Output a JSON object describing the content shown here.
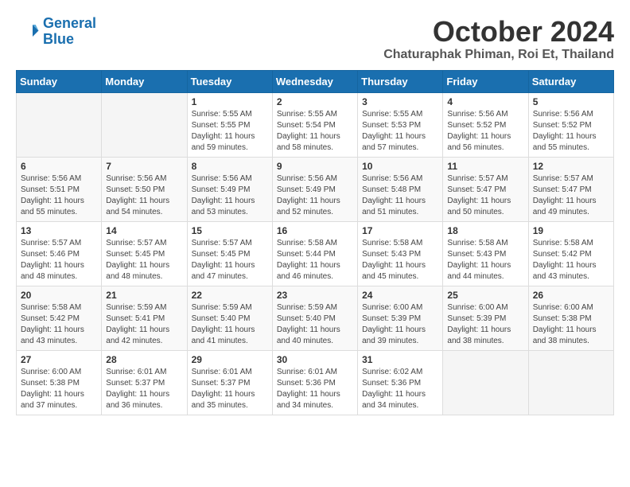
{
  "header": {
    "logo_line1": "General",
    "logo_line2": "Blue",
    "month": "October 2024",
    "location": "Chaturaphak Phiman, Roi Et, Thailand"
  },
  "weekdays": [
    "Sunday",
    "Monday",
    "Tuesday",
    "Wednesday",
    "Thursday",
    "Friday",
    "Saturday"
  ],
  "weeks": [
    [
      {
        "day": "",
        "info": ""
      },
      {
        "day": "",
        "info": ""
      },
      {
        "day": "1",
        "info": "Sunrise: 5:55 AM\nSunset: 5:55 PM\nDaylight: 11 hours and 59 minutes."
      },
      {
        "day": "2",
        "info": "Sunrise: 5:55 AM\nSunset: 5:54 PM\nDaylight: 11 hours and 58 minutes."
      },
      {
        "day": "3",
        "info": "Sunrise: 5:55 AM\nSunset: 5:53 PM\nDaylight: 11 hours and 57 minutes."
      },
      {
        "day": "4",
        "info": "Sunrise: 5:56 AM\nSunset: 5:52 PM\nDaylight: 11 hours and 56 minutes."
      },
      {
        "day": "5",
        "info": "Sunrise: 5:56 AM\nSunset: 5:52 PM\nDaylight: 11 hours and 55 minutes."
      }
    ],
    [
      {
        "day": "6",
        "info": "Sunrise: 5:56 AM\nSunset: 5:51 PM\nDaylight: 11 hours and 55 minutes."
      },
      {
        "day": "7",
        "info": "Sunrise: 5:56 AM\nSunset: 5:50 PM\nDaylight: 11 hours and 54 minutes."
      },
      {
        "day": "8",
        "info": "Sunrise: 5:56 AM\nSunset: 5:49 PM\nDaylight: 11 hours and 53 minutes."
      },
      {
        "day": "9",
        "info": "Sunrise: 5:56 AM\nSunset: 5:49 PM\nDaylight: 11 hours and 52 minutes."
      },
      {
        "day": "10",
        "info": "Sunrise: 5:56 AM\nSunset: 5:48 PM\nDaylight: 11 hours and 51 minutes."
      },
      {
        "day": "11",
        "info": "Sunrise: 5:57 AM\nSunset: 5:47 PM\nDaylight: 11 hours and 50 minutes."
      },
      {
        "day": "12",
        "info": "Sunrise: 5:57 AM\nSunset: 5:47 PM\nDaylight: 11 hours and 49 minutes."
      }
    ],
    [
      {
        "day": "13",
        "info": "Sunrise: 5:57 AM\nSunset: 5:46 PM\nDaylight: 11 hours and 48 minutes."
      },
      {
        "day": "14",
        "info": "Sunrise: 5:57 AM\nSunset: 5:45 PM\nDaylight: 11 hours and 48 minutes."
      },
      {
        "day": "15",
        "info": "Sunrise: 5:57 AM\nSunset: 5:45 PM\nDaylight: 11 hours and 47 minutes."
      },
      {
        "day": "16",
        "info": "Sunrise: 5:58 AM\nSunset: 5:44 PM\nDaylight: 11 hours and 46 minutes."
      },
      {
        "day": "17",
        "info": "Sunrise: 5:58 AM\nSunset: 5:43 PM\nDaylight: 11 hours and 45 minutes."
      },
      {
        "day": "18",
        "info": "Sunrise: 5:58 AM\nSunset: 5:43 PM\nDaylight: 11 hours and 44 minutes."
      },
      {
        "day": "19",
        "info": "Sunrise: 5:58 AM\nSunset: 5:42 PM\nDaylight: 11 hours and 43 minutes."
      }
    ],
    [
      {
        "day": "20",
        "info": "Sunrise: 5:58 AM\nSunset: 5:42 PM\nDaylight: 11 hours and 43 minutes."
      },
      {
        "day": "21",
        "info": "Sunrise: 5:59 AM\nSunset: 5:41 PM\nDaylight: 11 hours and 42 minutes."
      },
      {
        "day": "22",
        "info": "Sunrise: 5:59 AM\nSunset: 5:40 PM\nDaylight: 11 hours and 41 minutes."
      },
      {
        "day": "23",
        "info": "Sunrise: 5:59 AM\nSunset: 5:40 PM\nDaylight: 11 hours and 40 minutes."
      },
      {
        "day": "24",
        "info": "Sunrise: 6:00 AM\nSunset: 5:39 PM\nDaylight: 11 hours and 39 minutes."
      },
      {
        "day": "25",
        "info": "Sunrise: 6:00 AM\nSunset: 5:39 PM\nDaylight: 11 hours and 38 minutes."
      },
      {
        "day": "26",
        "info": "Sunrise: 6:00 AM\nSunset: 5:38 PM\nDaylight: 11 hours and 38 minutes."
      }
    ],
    [
      {
        "day": "27",
        "info": "Sunrise: 6:00 AM\nSunset: 5:38 PM\nDaylight: 11 hours and 37 minutes."
      },
      {
        "day": "28",
        "info": "Sunrise: 6:01 AM\nSunset: 5:37 PM\nDaylight: 11 hours and 36 minutes."
      },
      {
        "day": "29",
        "info": "Sunrise: 6:01 AM\nSunset: 5:37 PM\nDaylight: 11 hours and 35 minutes."
      },
      {
        "day": "30",
        "info": "Sunrise: 6:01 AM\nSunset: 5:36 PM\nDaylight: 11 hours and 34 minutes."
      },
      {
        "day": "31",
        "info": "Sunrise: 6:02 AM\nSunset: 5:36 PM\nDaylight: 11 hours and 34 minutes."
      },
      {
        "day": "",
        "info": ""
      },
      {
        "day": "",
        "info": ""
      }
    ]
  ]
}
